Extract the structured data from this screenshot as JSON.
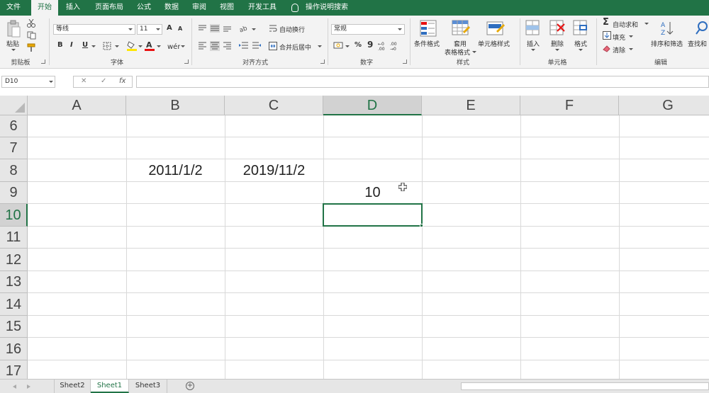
{
  "ribbon_tabs": [
    "文件",
    "开始",
    "插入",
    "页面布局",
    "公式",
    "数据",
    "审阅",
    "视图",
    "开发工具"
  ],
  "active_tab": "开始",
  "tell_me": "操作说明搜索",
  "clipboard": {
    "paste_label": "粘贴",
    "group_label": "剪贴板"
  },
  "font": {
    "name": "等线",
    "size": "11",
    "bold": "B",
    "italic": "I",
    "underline": "U",
    "grow": "A",
    "shrink": "A",
    "group_label": "字体"
  },
  "alignment": {
    "wrap_label": "自动换行",
    "merge_label": "合并后居中",
    "group_label": "对齐方式"
  },
  "number": {
    "format": "常规",
    "percent": "%",
    "comma": "9",
    "group_label": "数字"
  },
  "styles": {
    "conditional": "条件格式",
    "table_line1": "套用",
    "table_line2": "表格格式",
    "cell_styles": "单元格样式",
    "group_label": "样式"
  },
  "cells": {
    "insert": "插入",
    "delete": "删除",
    "format": "格式",
    "group_label": "单元格"
  },
  "editing": {
    "autosum": "自动求和",
    "fill": "填充",
    "clear": "清除",
    "sort": "排序和筛选",
    "find": "查找和",
    "group_label": "编辑"
  },
  "name_box": "D10",
  "formula_icons": {
    "cancel": "✕",
    "enter": "✓",
    "fx": "fx"
  },
  "columns": [
    "A",
    "B",
    "C",
    "D",
    "E",
    "F",
    "G"
  ],
  "selected_column": "D",
  "rows": [
    "6",
    "7",
    "8",
    "9",
    "10",
    "11",
    "12",
    "13",
    "14",
    "15",
    "16",
    "17"
  ],
  "selected_row": "10",
  "cells_data": {
    "B8": "2011/1/2",
    "C8": "2019/11/2",
    "D9": "10"
  },
  "sheets": [
    "Sheet2",
    "Sheet1",
    "Sheet3"
  ],
  "active_sheet": "Sheet1",
  "add_sheet": "+",
  "colors": {
    "excel_green": "#217346",
    "ribbon_bg": "#f3f3f3",
    "header_bg": "#e6e6e6"
  }
}
